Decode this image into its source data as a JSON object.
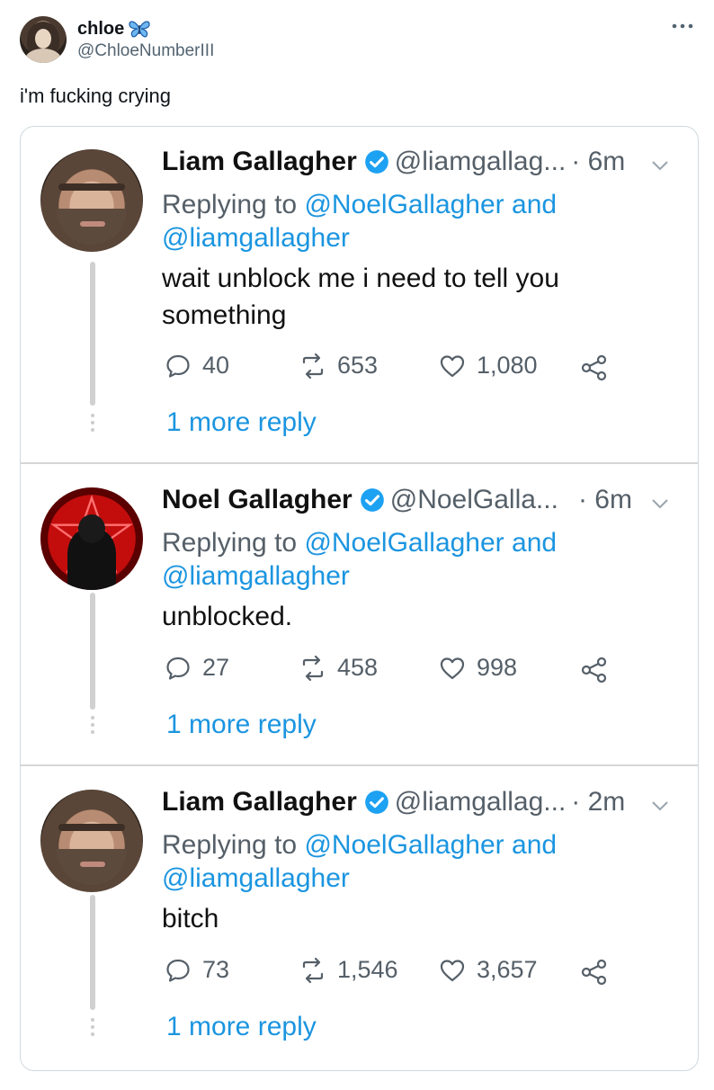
{
  "author": {
    "name": "chloe",
    "handle": "@ChloeNumberIII",
    "badge_icon": "butterfly-icon"
  },
  "post": {
    "text": "i'm fucking crying"
  },
  "thread": [
    {
      "name": "Liam Gallagher",
      "handle": "@liamgallag...",
      "time": "· 6m",
      "replying_prefix": "Replying to ",
      "replying_to_1": "@NoelGallagher",
      "replying_and": " and",
      "replying_to_2": "@liamgallagher",
      "body": "wait unblock me i need to tell you something",
      "replies": "40",
      "retweets": "653",
      "likes": "1,080",
      "more_reply": "1 more reply"
    },
    {
      "name": "Noel Gallagher",
      "handle": "@NoelGalla...",
      "time": "· 6m",
      "replying_prefix": "Replying to ",
      "replying_to_1": "@NoelGallagher",
      "replying_and": " and",
      "replying_to_2": "@liamgallagher",
      "body": "unblocked.",
      "replies": "27",
      "retweets": "458",
      "likes": "998",
      "more_reply": "1 more reply"
    },
    {
      "name": "Liam Gallagher",
      "handle": "@liamgallag...",
      "time": "· 2m",
      "replying_prefix": "Replying to ",
      "replying_to_1": "@NoelGallagher",
      "replying_and": " and",
      "replying_to_2": "@liamgallagher",
      "body": "bitch",
      "replies": "73",
      "retweets": "1,546",
      "likes": "3,657",
      "more_reply": "1 more reply"
    }
  ],
  "colors": {
    "link": "#1b95e0",
    "verified": "#1da1f2",
    "muted": "#555f68"
  }
}
